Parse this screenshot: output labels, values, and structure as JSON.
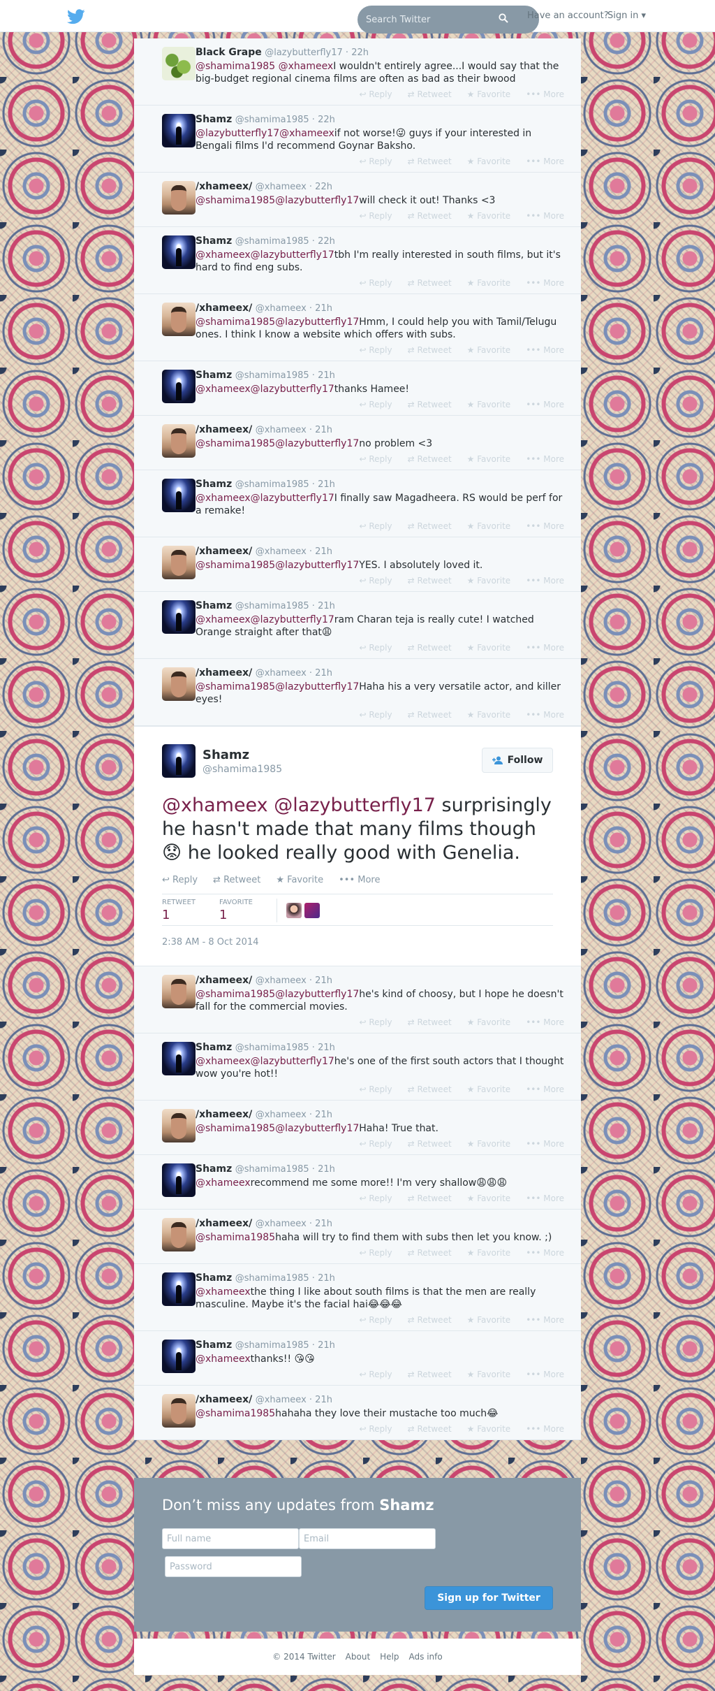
{
  "topbar": {
    "search_placeholder": "Search Twitter",
    "have_account": "Have an account?",
    "signin_label": "Sign in",
    "signin_caret": "▾"
  },
  "actions": {
    "reply": "Reply",
    "retweet": "Retweet",
    "favorite": "Favorite",
    "more": "More"
  },
  "tweets_before": [
    {
      "name": "Black Grape",
      "handle": "@lazybutterfly17",
      "time": "22h",
      "avatar": "grape",
      "mentions": [
        "@shamima1985",
        "@xhameex"
      ],
      "text": "I wouldn't entirely agree...I would say that the big-budget regional cinema films are often as bad as their bwood"
    },
    {
      "name": "Shamz",
      "handle": "@shamima1985",
      "time": "22h",
      "avatar": "shamz",
      "mentions": [
        "@lazybutterfly17",
        "@xhameex"
      ],
      "text": "if not worse!😜 guys if your interested in Bengali  films I'd recommend Goynar Baksho."
    },
    {
      "name": "/xhameex/",
      "handle": "@xhameex",
      "time": "22h",
      "avatar": "xham",
      "mentions": [
        "@shamima1985",
        "@lazybutterfly17"
      ],
      "text": "will check it out! Thanks <3"
    },
    {
      "name": "Shamz",
      "handle": "@shamima1985",
      "time": "22h",
      "avatar": "shamz",
      "mentions": [
        "@xhameex",
        "@lazybutterfly17"
      ],
      "text": "tbh I'm really interested in south films, but it's hard to find eng subs."
    },
    {
      "name": "/xhameex/",
      "handle": "@xhameex",
      "time": "21h",
      "avatar": "xham",
      "mentions": [
        "@shamima1985",
        "@lazybutterfly17"
      ],
      "text": "Hmm, I could help you with Tamil/Telugu ones. I think I know a website which offers with subs."
    },
    {
      "name": "Shamz",
      "handle": "@shamima1985",
      "time": "21h",
      "avatar": "shamz",
      "mentions": [
        "@xhameex",
        "@lazybutterfly17"
      ],
      "text": "thanks Hamee!"
    },
    {
      "name": "/xhameex/",
      "handle": "@xhameex",
      "time": "21h",
      "avatar": "xham",
      "mentions": [
        "@shamima1985",
        "@lazybutterfly17"
      ],
      "text": "no problem <3"
    },
    {
      "name": "Shamz",
      "handle": "@shamima1985",
      "time": "21h",
      "avatar": "shamz",
      "mentions": [
        "@xhameex",
        "@lazybutterfly17"
      ],
      "text": "I finally saw Magadheera. RS would be perf for a remake!"
    },
    {
      "name": "/xhameex/",
      "handle": "@xhameex",
      "time": "21h",
      "avatar": "xham",
      "mentions": [
        "@shamima1985",
        "@lazybutterfly17"
      ],
      "text": "YES. I absolutely loved it."
    },
    {
      "name": "Shamz",
      "handle": "@shamima1985",
      "time": "21h",
      "avatar": "shamz",
      "mentions": [
        "@xhameex",
        "@lazybutterfly17"
      ],
      "text": "ram Charan teja is really cute! I watched Orange straight after that😩"
    },
    {
      "name": "/xhameex/",
      "handle": "@xhameex",
      "time": "21h",
      "avatar": "xham",
      "mentions": [
        "@shamima1985",
        "@lazybutterfly17"
      ],
      "text": "Haha his a very versatile actor, and killer eyes!"
    }
  ],
  "focused": {
    "name": "Shamz",
    "handle": "@shamima1985",
    "follow_label": "Follow",
    "mentions": [
      "@xhameex",
      "@lazybutterfly17"
    ],
    "text": "surprisingly he hasn't made that many films though 😟 he looked really good with Genelia.",
    "retweet_label": "RETWEET",
    "retweet_count": "1",
    "favorite_label": "FAVORITE",
    "favorite_count": "1",
    "date": "2:38 AM - 8 Oct 2014"
  },
  "tweets_after": [
    {
      "name": "/xhameex/",
      "handle": "@xhameex",
      "time": "21h",
      "avatar": "xham",
      "mentions": [
        "@shamima1985",
        "@lazybutterfly17"
      ],
      "text": "he's kind of choosy, but I hope he doesn't fall for the commercial movies."
    },
    {
      "name": "Shamz",
      "handle": "@shamima1985",
      "time": "21h",
      "avatar": "shamz",
      "mentions": [
        "@xhameex",
        "@lazybutterfly17"
      ],
      "text": "he's one of the  first south actors that I thought wow you're hot!!"
    },
    {
      "name": "/xhameex/",
      "handle": "@xhameex",
      "time": "21h",
      "avatar": "xham",
      "mentions": [
        "@shamima1985",
        "@lazybutterfly17"
      ],
      "text": "Haha! True that."
    },
    {
      "name": "Shamz",
      "handle": "@shamima1985",
      "time": "21h",
      "avatar": "shamz",
      "mentions": [
        "@xhameex"
      ],
      "text": "recommend me some more!! I'm very shallow😩😩😩"
    },
    {
      "name": "/xhameex/",
      "handle": "@xhameex",
      "time": "21h",
      "avatar": "xham",
      "mentions": [
        "@shamima1985"
      ],
      "text": "haha will try to find them with subs then let you know. ;)"
    },
    {
      "name": "Shamz",
      "handle": "@shamima1985",
      "time": "21h",
      "avatar": "shamz",
      "mentions": [
        "@xhameex"
      ],
      "text": "the thing I like about south films is that the men are really masculine. Maybe it's the facial hai😂😂😂"
    },
    {
      "name": "Shamz",
      "handle": "@shamima1985",
      "time": "21h",
      "avatar": "shamz",
      "mentions": [
        "@xhameex"
      ],
      "text": "thanks!! 😘😘"
    },
    {
      "name": "/xhameex/",
      "handle": "@xhameex",
      "time": "21h",
      "avatar": "xham",
      "mentions": [
        "@shamima1985"
      ],
      "text": "hahaha they love their mustache too much😂"
    }
  ],
  "signup": {
    "heading_prefix": "Don’t miss any updates from",
    "heading_name": "Shamz",
    "fullname_placeholder": "Full name",
    "email_placeholder": "Email",
    "password_placeholder": "Password",
    "button_label": "Sign up for Twitter"
  },
  "footer": {
    "copyright": "© 2014 Twitter",
    "about": "About",
    "help": "Help",
    "ads": "Ads info"
  },
  "colors": {
    "link": "#78214b",
    "accent": "#3b94d9",
    "twitter_blue": "#55acee",
    "signup_bg": "#8899a6"
  }
}
